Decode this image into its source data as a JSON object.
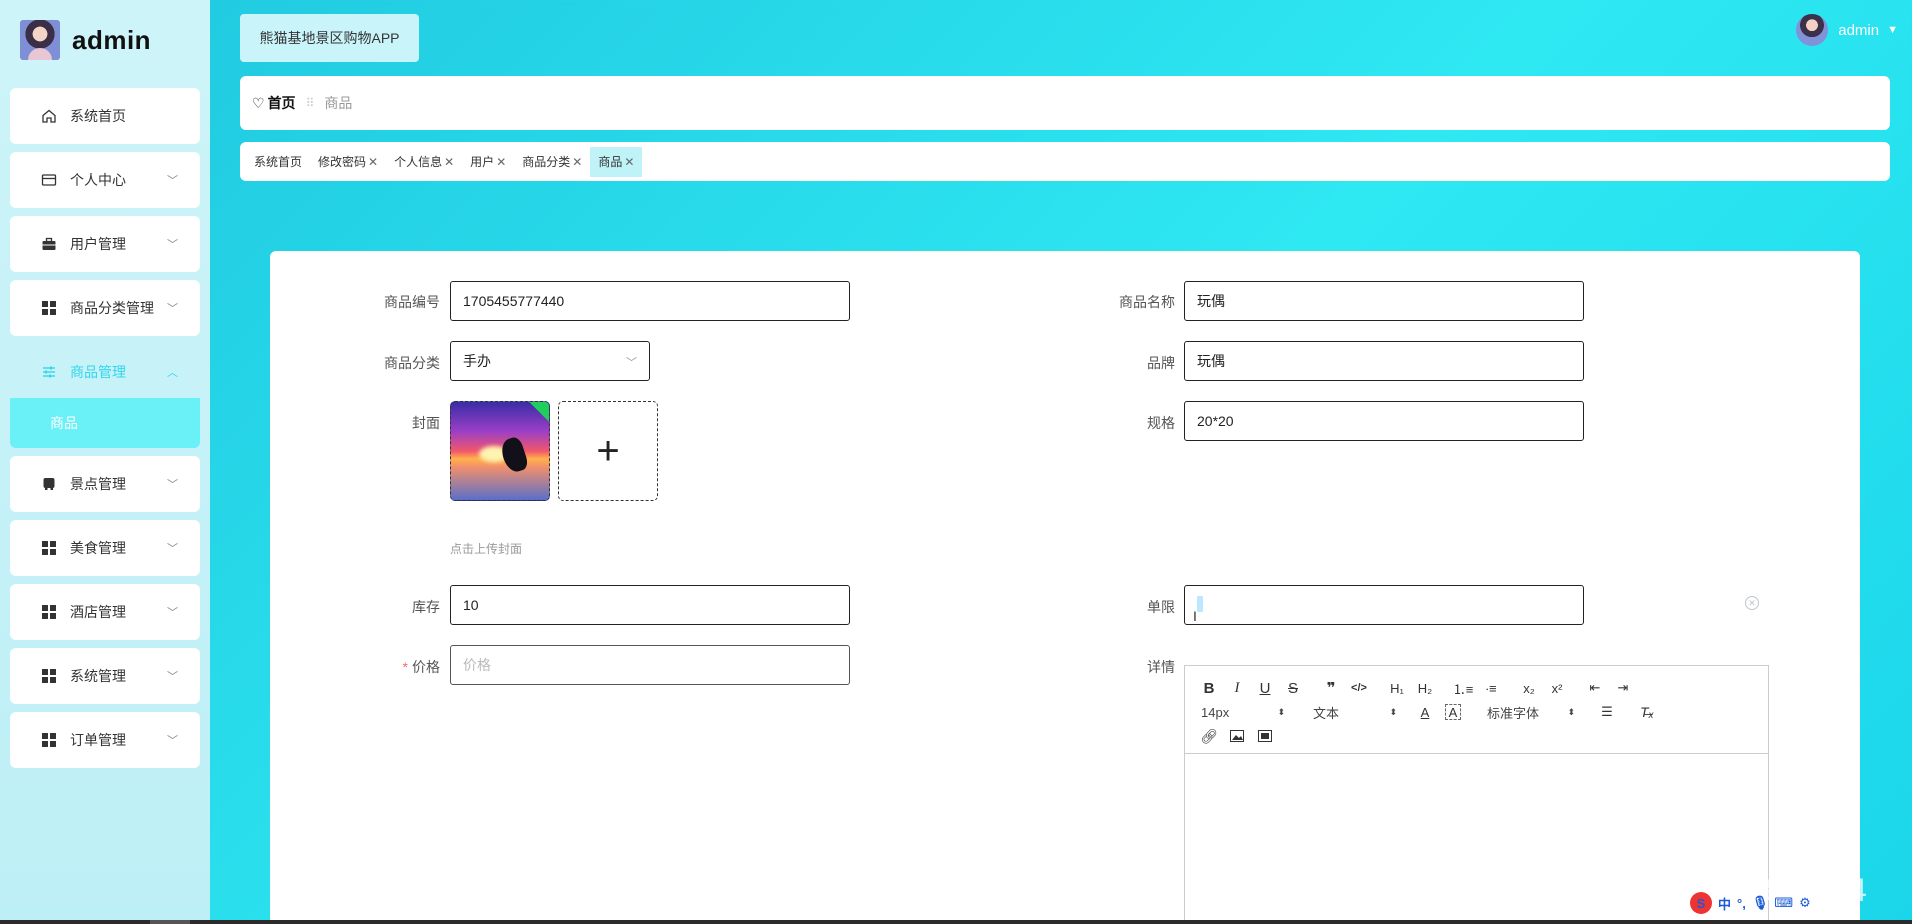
{
  "brand": {
    "name": "admin"
  },
  "sidebar": {
    "items": [
      {
        "label": "系统首页",
        "icon": "home-icon",
        "has_children": false
      },
      {
        "label": "个人中心",
        "icon": "card-icon",
        "has_children": true
      },
      {
        "label": "用户管理",
        "icon": "briefcase-icon",
        "has_children": true
      },
      {
        "label": "商品分类管理",
        "icon": "grid-icon",
        "has_children": true
      },
      {
        "label": "商品管理",
        "icon": "sliders-icon",
        "has_children": true,
        "expanded": true,
        "children": [
          {
            "label": "商品"
          }
        ]
      },
      {
        "label": "景点管理",
        "icon": "bus-icon",
        "has_children": true
      },
      {
        "label": "美食管理",
        "icon": "grid-icon",
        "has_children": true
      },
      {
        "label": "酒店管理",
        "icon": "grid-icon",
        "has_children": true
      },
      {
        "label": "系统管理",
        "icon": "grid-icon",
        "has_children": true
      },
      {
        "label": "订单管理",
        "icon": "grid-icon",
        "has_children": true
      }
    ]
  },
  "header": {
    "app_title": "熊猫基地景区购物APP",
    "user_name": "admin"
  },
  "breadcrumb": {
    "home": "首页",
    "separator": "⠿",
    "current": "商品"
  },
  "tabs": [
    {
      "label": "系统首页",
      "closable": false,
      "active": false
    },
    {
      "label": "修改密码",
      "closable": true,
      "active": false
    },
    {
      "label": "个人信息",
      "closable": true,
      "active": false
    },
    {
      "label": "用户",
      "closable": true,
      "active": false
    },
    {
      "label": "商品分类",
      "closable": true,
      "active": false
    },
    {
      "label": "商品",
      "closable": true,
      "active": true
    }
  ],
  "form": {
    "code_label": "商品编号",
    "code_value": "1705455777440",
    "name_label": "商品名称",
    "name_value": "玩偶",
    "category_label": "商品分类",
    "category_value": "手办",
    "brand_label": "品牌",
    "brand_value": "玩偶",
    "cover_label": "封面",
    "cover_tip": "点击上传封面",
    "spec_label": "规格",
    "spec_value": "20*20",
    "stock_label": "库存",
    "stock_value": "10",
    "limit_label": "单限",
    "limit_value": "",
    "price_label": "价格",
    "price_placeholder": "价格",
    "price_required": "*",
    "detail_label": "详情"
  },
  "editor": {
    "font_size": "14px",
    "text_type": "文本",
    "font_family": "标准字体"
  },
  "watermark": "CSDN @QQ3359892174",
  "ime": {
    "lang": "中",
    "logo": "S"
  },
  "colors": {
    "accent": "#33d6ec",
    "submenu_bg": "#6af0f7",
    "required": "#f56c6c"
  }
}
